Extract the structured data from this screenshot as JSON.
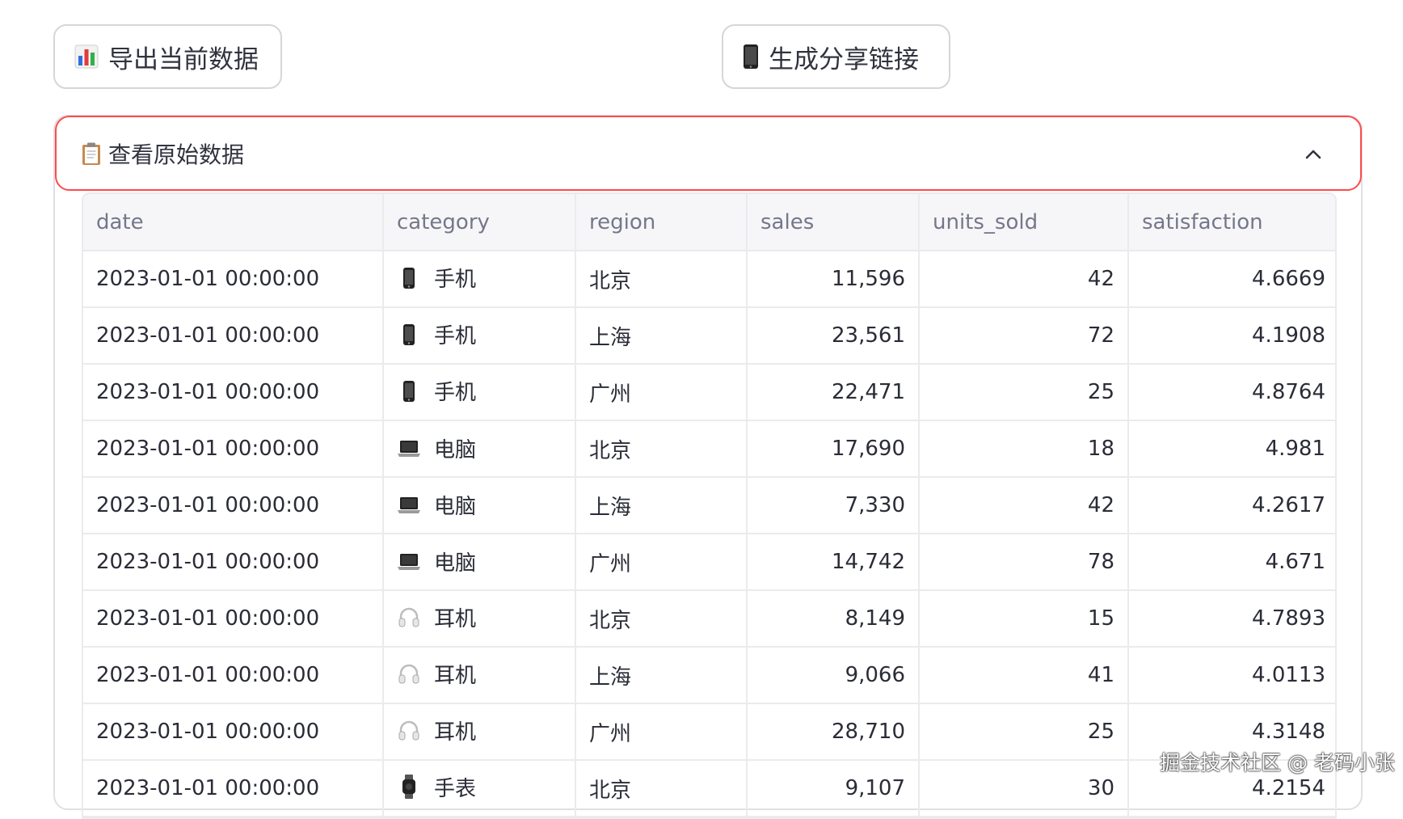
{
  "toolbar": {
    "export_label": "导出当前数据",
    "share_label": "生成分享链接"
  },
  "expander": {
    "title": "查看原始数据",
    "expanded": true,
    "accent_color": "#ff4b4b"
  },
  "table": {
    "columns": [
      "date",
      "category",
      "region",
      "sales",
      "units_sold",
      "satisfaction"
    ],
    "rows": [
      {
        "date": "2023-01-01 00:00:00",
        "category_icon": "phone-icon",
        "category": "手机",
        "region": "北京",
        "sales": "11,596",
        "units_sold": "42",
        "satisfaction": "4.6669"
      },
      {
        "date": "2023-01-01 00:00:00",
        "category_icon": "phone-icon",
        "category": "手机",
        "region": "上海",
        "sales": "23,561",
        "units_sold": "72",
        "satisfaction": "4.1908"
      },
      {
        "date": "2023-01-01 00:00:00",
        "category_icon": "phone-icon",
        "category": "手机",
        "region": "广州",
        "sales": "22,471",
        "units_sold": "25",
        "satisfaction": "4.8764"
      },
      {
        "date": "2023-01-01 00:00:00",
        "category_icon": "laptop-icon",
        "category": "电脑",
        "region": "北京",
        "sales": "17,690",
        "units_sold": "18",
        "satisfaction": "4.981"
      },
      {
        "date": "2023-01-01 00:00:00",
        "category_icon": "laptop-icon",
        "category": "电脑",
        "region": "上海",
        "sales": "7,330",
        "units_sold": "42",
        "satisfaction": "4.2617"
      },
      {
        "date": "2023-01-01 00:00:00",
        "category_icon": "laptop-icon",
        "category": "电脑",
        "region": "广州",
        "sales": "14,742",
        "units_sold": "78",
        "satisfaction": "4.671"
      },
      {
        "date": "2023-01-01 00:00:00",
        "category_icon": "headphones-icon",
        "category": "耳机",
        "region": "北京",
        "sales": "8,149",
        "units_sold": "15",
        "satisfaction": "4.7893"
      },
      {
        "date": "2023-01-01 00:00:00",
        "category_icon": "headphones-icon",
        "category": "耳机",
        "region": "上海",
        "sales": "9,066",
        "units_sold": "41",
        "satisfaction": "4.0113"
      },
      {
        "date": "2023-01-01 00:00:00",
        "category_icon": "headphones-icon",
        "category": "耳机",
        "region": "广州",
        "sales": "28,710",
        "units_sold": "25",
        "satisfaction": "4.3148"
      },
      {
        "date": "2023-01-01 00:00:00",
        "category_icon": "watch-icon",
        "category": "手表",
        "region": "北京",
        "sales": "9,107",
        "units_sold": "30",
        "satisfaction": "4.2154"
      }
    ]
  },
  "watermark": "掘金技术社区 @ 老码小张"
}
